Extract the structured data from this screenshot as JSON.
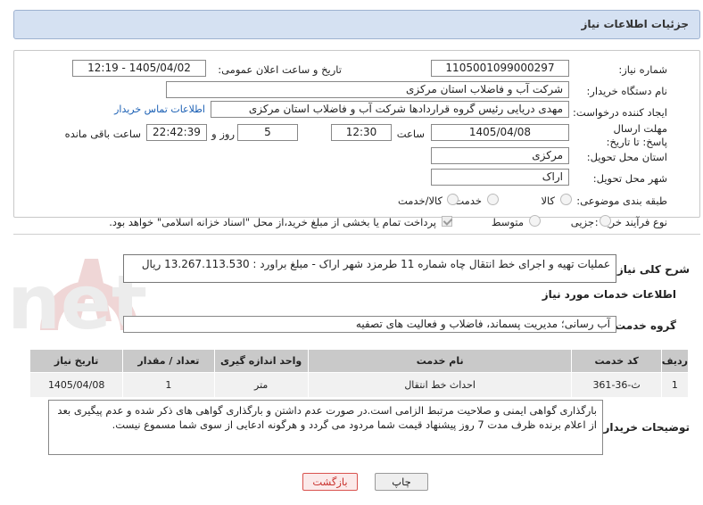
{
  "page_title": "جزئیات اطلاعات نیاز",
  "fields": {
    "need_number_label": "شماره نیاز:",
    "need_number": "1105001099000297",
    "announce_label": "تاریخ و ساعت اعلان عمومی:",
    "announce_value": "1405/04/02 - 12:19",
    "buyer_org_label": "نام دستگاه خریدار:",
    "buyer_org": "شرکت آب و فاضلاب استان مرکزی",
    "creator_label": "ایجاد کننده درخواست:",
    "creator": "مهدی دریایی رئیس گروه قراردادها شرکت آب و فاضلاب استان مرکزی",
    "buyer_contact_link": "اطلاعات تماس خریدار",
    "deadline_label": "مهلت ارسال پاسخ: تا تاریخ:",
    "deadline_date": "1405/04/08",
    "time_label": "ساعت",
    "deadline_time": "12:30",
    "days_value": "5",
    "days_label": "روز و",
    "remaining_time": "22:42:39",
    "remaining_label": "ساعت باقی مانده",
    "province_label": "استان محل تحویل:",
    "province": "مرکزی",
    "city_label": "شهر محل تحویل:",
    "city": "اراک",
    "category_label": "طبقه بندی موضوعی:",
    "category_options": [
      "کالا",
      "خدمت",
      "کالا/خدمت"
    ],
    "process_label": "نوع فرآیند خرید :",
    "process_options": [
      "جزیی",
      "متوسط"
    ],
    "payment_note": "پرداخت تمام یا بخشی از مبلغ خرید،از محل \"اسناد خزانه اسلامی\" خواهد بود."
  },
  "summary": {
    "label": "شرح کلی نیاز:",
    "text": "عملیات تهیه و اجرای خط انتقال چاه شماره 11 طرمزد شهر اراک - مبلغ براورد : 13.267.113.530 ریال"
  },
  "services_section": {
    "heading": "اطلاعات خدمات مورد نیاز",
    "group_label": "گروه خدمت:",
    "group_value": "آب رسانی؛ مدیریت پسماند، فاضلاب و فعالیت های تصفیه"
  },
  "table": {
    "headers": [
      "ردیف",
      "کد خدمت",
      "نام خدمت",
      "واحد اندازه گیری",
      "تعداد / مقدار",
      "تاریخ نیاز"
    ],
    "rows": [
      [
        "1",
        "ث-36-361",
        "احداث خط انتقال",
        "متر",
        "1",
        "1405/04/08"
      ]
    ]
  },
  "buyer_notes": {
    "label": "توضیحات خریدار:",
    "text": "بارگذاری گواهی ایمنی و صلاحیت مرتبط الزامی است.در صورت عدم داشتن و بارگذاری گواهی های ذکر شده و عدم پیگیری بعد از اعلام برنده ظرف مدت 7 روز پیشنهاد قیمت شما مردود می گردد و هرگونه ادعایی از سوی شما مسموع نیست."
  },
  "buttons": {
    "print": "چاپ",
    "back": "بازگشت"
  },
  "watermark_text": "AriaTender.net",
  "colors": {
    "title_bg": "#d5e1f2",
    "link": "#1a5fb4",
    "back_button_border": "#d9534f",
    "watermark": "#e8e8e8"
  }
}
